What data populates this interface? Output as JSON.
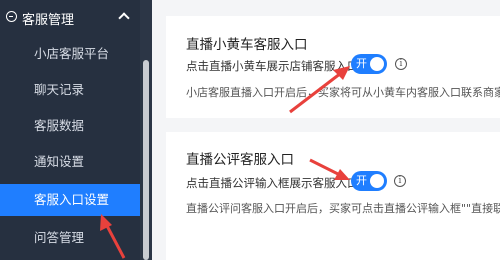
{
  "sidebar": {
    "group_label": "客服管理",
    "items": [
      {
        "label": "小店客服平台"
      },
      {
        "label": "聊天记录"
      },
      {
        "label": "客服数据"
      },
      {
        "label": "通知设置"
      },
      {
        "label": "客服入口设置"
      },
      {
        "label": "问答管理"
      }
    ]
  },
  "cards": [
    {
      "title": "直播小黄车客服入口",
      "setting_label": "点击直播小黄车展示店铺客服入口",
      "toggle_label": "开",
      "description": "小店客服直播入口开启后，买家将可从小黄车内客服入口联系商家客"
    },
    {
      "title": "直播公评客服入口",
      "setting_label": "点击直播公评输入框展示客服入口",
      "toggle_label": "开",
      "description": "直播公评问客服入口开启后，买家可点击直播公评输入框\"\"直接联系"
    }
  ],
  "colors": {
    "sidebar_bg": "#263040",
    "active_item": "#1f7eff",
    "toggle_on": "#1f7eff",
    "annotation_arrow": "#e8413c"
  }
}
